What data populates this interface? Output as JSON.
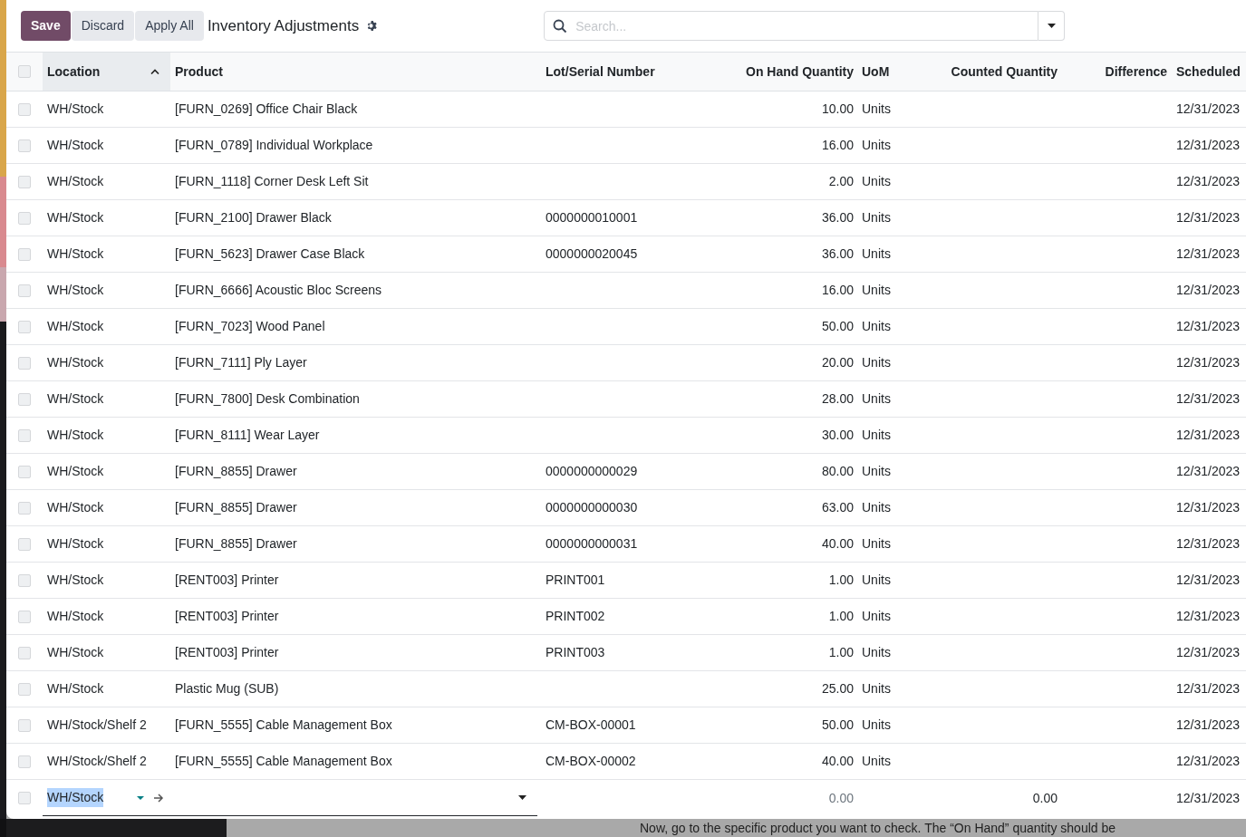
{
  "toolbar": {
    "buttons": [
      {
        "label": "Save",
        "kind": "primary"
      },
      {
        "label": "Discard",
        "kind": "secondary"
      },
      {
        "label": "Apply All",
        "kind": "secondary"
      }
    ],
    "title": "Inventory Adjustments"
  },
  "search": {
    "placeholder": "Search..."
  },
  "table": {
    "select_all": {
      "checked": false
    },
    "columns": [
      {
        "label": "Location",
        "sorted": true
      },
      {
        "label": "Product",
        "sorted": false
      },
      {
        "label": "Lot/Serial Number",
        "sorted": false
      },
      {
        "label": "On Hand Quantity",
        "sorted": false
      },
      {
        "label": "UoM",
        "sorted": false
      },
      {
        "label": "Counted Quantity",
        "sorted": false
      },
      {
        "label": "Difference",
        "sorted": false
      },
      {
        "label": "Scheduled",
        "sorted": false
      }
    ],
    "rows": [
      {
        "checked": false,
        "location": "WH/Stock",
        "product": "[FURN_0269] Office Chair Black",
        "lot": "",
        "on_hand": "10.00",
        "uom": "Units",
        "date": "12/31/2023"
      },
      {
        "checked": false,
        "location": "WH/Stock",
        "product": "[FURN_0789] Individual Workplace",
        "lot": "",
        "on_hand": "16.00",
        "uom": "Units",
        "date": "12/31/2023"
      },
      {
        "checked": false,
        "location": "WH/Stock",
        "product": "[FURN_1118] Corner Desk Left Sit",
        "lot": "",
        "on_hand": "2.00",
        "uom": "Units",
        "date": "12/31/2023"
      },
      {
        "checked": false,
        "location": "WH/Stock",
        "product": "[FURN_2100] Drawer Black",
        "lot": "0000000010001",
        "on_hand": "36.00",
        "uom": "Units",
        "date": "12/31/2023"
      },
      {
        "checked": false,
        "location": "WH/Stock",
        "product": "[FURN_5623] Drawer Case Black",
        "lot": "0000000020045",
        "on_hand": "36.00",
        "uom": "Units",
        "date": "12/31/2023"
      },
      {
        "checked": false,
        "location": "WH/Stock",
        "product": "[FURN_6666] Acoustic Bloc Screens",
        "lot": "",
        "on_hand": "16.00",
        "uom": "Units",
        "date": "12/31/2023"
      },
      {
        "checked": false,
        "location": "WH/Stock",
        "product": "[FURN_7023] Wood Panel",
        "lot": "",
        "on_hand": "50.00",
        "uom": "Units",
        "date": "12/31/2023"
      },
      {
        "checked": false,
        "location": "WH/Stock",
        "product": "[FURN_7111] Ply Layer",
        "lot": "",
        "on_hand": "20.00",
        "uom": "Units",
        "date": "12/31/2023"
      },
      {
        "checked": false,
        "location": "WH/Stock",
        "product": "[FURN_7800] Desk Combination",
        "lot": "",
        "on_hand": "28.00",
        "uom": "Units",
        "date": "12/31/2023"
      },
      {
        "checked": false,
        "location": "WH/Stock",
        "product": "[FURN_8111] Wear Layer",
        "lot": "",
        "on_hand": "30.00",
        "uom": "Units",
        "date": "12/31/2023"
      },
      {
        "checked": false,
        "location": "WH/Stock",
        "product": "[FURN_8855] Drawer",
        "lot": "0000000000029",
        "on_hand": "80.00",
        "uom": "Units",
        "date": "12/31/2023"
      },
      {
        "checked": false,
        "location": "WH/Stock",
        "product": "[FURN_8855] Drawer",
        "lot": "0000000000030",
        "on_hand": "63.00",
        "uom": "Units",
        "date": "12/31/2023"
      },
      {
        "checked": false,
        "location": "WH/Stock",
        "product": "[FURN_8855] Drawer",
        "lot": "0000000000031",
        "on_hand": "40.00",
        "uom": "Units",
        "date": "12/31/2023"
      },
      {
        "checked": false,
        "location": "WH/Stock",
        "product": "[RENT003] Printer",
        "lot": "PRINT001",
        "on_hand": "1.00",
        "uom": "Units",
        "date": "12/31/2023"
      },
      {
        "checked": false,
        "location": "WH/Stock",
        "product": "[RENT003] Printer",
        "lot": "PRINT002",
        "on_hand": "1.00",
        "uom": "Units",
        "date": "12/31/2023"
      },
      {
        "checked": false,
        "location": "WH/Stock",
        "product": "[RENT003] Printer",
        "lot": "PRINT003",
        "on_hand": "1.00",
        "uom": "Units",
        "date": "12/31/2023"
      },
      {
        "checked": false,
        "location": "WH/Stock",
        "product": "Plastic Mug (SUB)",
        "lot": "",
        "on_hand": "25.00",
        "uom": "Units",
        "date": "12/31/2023"
      },
      {
        "checked": false,
        "location": "WH/Stock/Shelf 2",
        "product": "[FURN_5555] Cable Management Box",
        "lot": "CM-BOX-00001",
        "on_hand": "50.00",
        "uom": "Units",
        "date": "12/31/2023"
      },
      {
        "checked": false,
        "location": "WH/Stock/Shelf 2",
        "product": "[FURN_5555] Cable Management Box",
        "lot": "CM-BOX-00002",
        "on_hand": "40.00",
        "uom": "Units",
        "date": "12/31/2023"
      }
    ],
    "new_line": {
      "checked": false,
      "location": "WH/Stock",
      "on_hand": "0.00",
      "counted": "0.00",
      "date": "12/31/2023"
    }
  },
  "background_text": "Now, go to the specific product you want to check. The “On Hand” quantity should be"
}
